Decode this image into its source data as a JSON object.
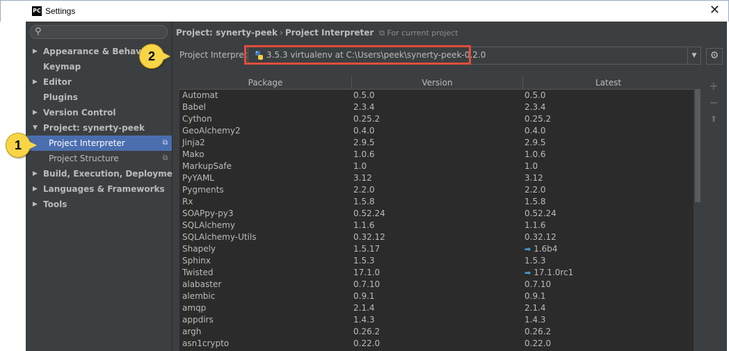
{
  "window": {
    "app_icon": "PC",
    "title": "Settings",
    "close": "✕"
  },
  "sidebar": {
    "search_placeholder": "",
    "items": [
      {
        "label": "Appearance & Behavior",
        "arrow": "▶"
      },
      {
        "label": "Keymap",
        "arrow": ""
      },
      {
        "label": "Editor",
        "arrow": "▶"
      },
      {
        "label": "Plugins",
        "arrow": ""
      },
      {
        "label": "Version Control",
        "arrow": "▶"
      },
      {
        "label": "Project: synerty-peek",
        "arrow": "▼"
      },
      {
        "label": "Project Interpreter",
        "arrow": ""
      },
      {
        "label": "Project Structure",
        "arrow": ""
      },
      {
        "label": "Build, Execution, Deployment",
        "arrow": "▶"
      },
      {
        "label": "Languages & Frameworks",
        "arrow": "▶"
      },
      {
        "label": "Tools",
        "arrow": "▶"
      }
    ]
  },
  "breadcrumb": {
    "part1": "Project: synerty-peek",
    "sep": "›",
    "part2": "Project Interpreter",
    "note": "For current project"
  },
  "interpreter": {
    "label": "Project Interpreter",
    "value": "3.5.3 virtualenv at C:\\Users\\peek\\synerty-peek-0.2.0"
  },
  "table": {
    "headers": [
      "Package",
      "Version",
      "Latest"
    ],
    "rows": [
      {
        "package": "Automat",
        "version": "0.5.0",
        "latest": "0.5.0",
        "update": false
      },
      {
        "package": "Babel",
        "version": "2.3.4",
        "latest": "2.3.4",
        "update": false
      },
      {
        "package": "Cython",
        "version": "0.25.2",
        "latest": "0.25.2",
        "update": false
      },
      {
        "package": "GeoAlchemy2",
        "version": "0.4.0",
        "latest": "0.4.0",
        "update": false
      },
      {
        "package": "Jinja2",
        "version": "2.9.5",
        "latest": "2.9.5",
        "update": false
      },
      {
        "package": "Mako",
        "version": "1.0.6",
        "latest": "1.0.6",
        "update": false
      },
      {
        "package": "MarkupSafe",
        "version": "1.0",
        "latest": "1.0",
        "update": false
      },
      {
        "package": "PyYAML",
        "version": "3.12",
        "latest": "3.12",
        "update": false
      },
      {
        "package": "Pygments",
        "version": "2.2.0",
        "latest": "2.2.0",
        "update": false
      },
      {
        "package": "Rx",
        "version": "1.5.8",
        "latest": "1.5.8",
        "update": false
      },
      {
        "package": "SOAPpy-py3",
        "version": "0.52.24",
        "latest": "0.52.24",
        "update": false
      },
      {
        "package": "SQLAlchemy",
        "version": "1.1.6",
        "latest": "1.1.6",
        "update": false
      },
      {
        "package": "SQLAlchemy-Utils",
        "version": "0.32.12",
        "latest": "0.32.12",
        "update": false
      },
      {
        "package": "Shapely",
        "version": "1.5.17",
        "latest": "1.6b4",
        "update": true
      },
      {
        "package": "Sphinx",
        "version": "1.5.3",
        "latest": "1.5.3",
        "update": false
      },
      {
        "package": "Twisted",
        "version": "17.1.0",
        "latest": "17.1.0rc1",
        "update": true
      },
      {
        "package": "alabaster",
        "version": "0.7.10",
        "latest": "0.7.10",
        "update": false
      },
      {
        "package": "alembic",
        "version": "0.9.1",
        "latest": "0.9.1",
        "update": false
      },
      {
        "package": "amqp",
        "version": "2.1.4",
        "latest": "2.1.4",
        "update": false
      },
      {
        "package": "appdirs",
        "version": "1.4.3",
        "latest": "1.4.3",
        "update": false
      },
      {
        "package": "argh",
        "version": "0.26.2",
        "latest": "0.26.2",
        "update": false
      },
      {
        "package": "asn1crypto",
        "version": "0.22.0",
        "latest": "0.22.0",
        "update": false
      }
    ]
  },
  "side_tools": {
    "add": "+",
    "remove": "−",
    "upgrade": "⬆"
  },
  "callouts": {
    "one": "1",
    "two": "2"
  },
  "colors": {
    "selection": "#4b6eaf",
    "highlight": "#e04e3c",
    "callout": "#f7d547",
    "update_arrow": "#4a9ed8"
  }
}
